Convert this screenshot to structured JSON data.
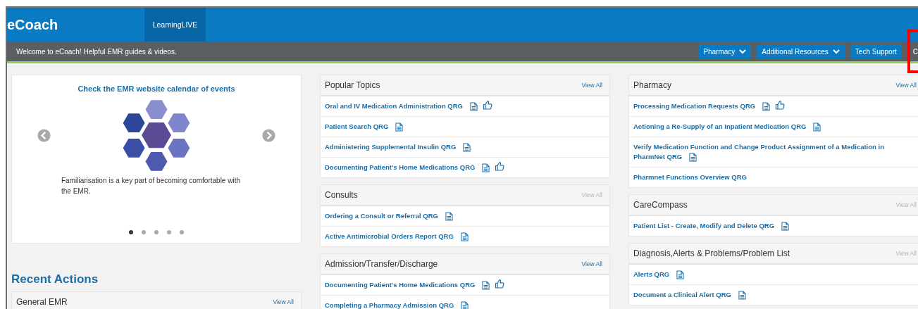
{
  "header": {
    "title": "eCoach",
    "tabs": [
      {
        "label": "LearningLIVE",
        "selected": true
      }
    ]
  },
  "nav": {
    "welcome": "Welcome to eCoach! Helpful EMR guides & videos.",
    "buttons": [
      {
        "label": "Pharmacy",
        "dropdown": true
      },
      {
        "label": "Additional Resources",
        "dropdown": true
      },
      {
        "label": "Tech Support",
        "dropdown": false
      },
      {
        "label": "C",
        "dropdown": false
      }
    ]
  },
  "annotation_frame": true,
  "carousel": {
    "heading": "Check the EMR website calendar of events",
    "caption": "Familiarisation is a key part of becoming comfortable with the EMR.",
    "dots": [
      {
        "selected": true
      },
      {
        "selected": false
      },
      {
        "selected": false
      },
      {
        "selected": false
      },
      {
        "selected": false
      }
    ]
  },
  "recent_actions": {
    "title": "Recent Actions",
    "panels": [
      {
        "title": "General EMR",
        "view_all": "View All",
        "view_all_enabled": true
      }
    ]
  },
  "columns": [
    [
      {
        "title": "Popular Topics",
        "view_all": "View All",
        "view_all_enabled": true,
        "items": [
          {
            "label": "Oral and IV Medication Administration QRG",
            "document": true,
            "liked": true
          },
          {
            "label": "Patient Search QRG",
            "document": true,
            "liked": false
          },
          {
            "label": "Administering Supplemental Insulin QRG",
            "document": true,
            "liked": false
          },
          {
            "label": "Documenting Patient's Home Medications QRG",
            "document": true,
            "liked": true
          }
        ]
      },
      {
        "title": "Consults",
        "view_all": "View All",
        "view_all_enabled": false,
        "items": [
          {
            "label": "Ordering a Consult or Referral QRG",
            "document": true,
            "liked": false
          },
          {
            "label": "Active Antimicrobial Orders Report QRG",
            "document": true,
            "liked": false
          }
        ]
      },
      {
        "title": "Admission/Transfer/Discharge",
        "view_all": "View All",
        "view_all_enabled": true,
        "items": [
          {
            "label": "Documenting Patient's Home Medications QRG",
            "document": true,
            "liked": true
          },
          {
            "label": "Completing a Pharmacy Admission QRG",
            "document": true,
            "liked": false
          }
        ]
      }
    ],
    [
      {
        "title": "Pharmacy",
        "view_all": "View All",
        "view_all_enabled": true,
        "items": [
          {
            "label": "Processing Medication Requests QRG",
            "document": true,
            "liked": true
          },
          {
            "label": "Actioning a Re-Supply of an Inpatient Medication QRG",
            "document": true,
            "liked": false
          },
          {
            "label": "Verify Medication Function and Change Product Assignment of a Medication in PharmNet QRG",
            "document": true,
            "liked": false
          },
          {
            "label": "Pharmnet Functions Overview QRG",
            "document": false,
            "liked": false
          }
        ]
      },
      {
        "title": "CareCompass",
        "view_all": "View All",
        "view_all_enabled": false,
        "items": [
          {
            "label": "Patient List - Create, Modify and Delete QRG",
            "document": true,
            "liked": false
          }
        ]
      },
      {
        "title": "Diagnosis,Alerts & Problems/Problem List",
        "view_all": "View All",
        "view_all_enabled": false,
        "items": [
          {
            "label": "Alerts QRG",
            "document": true,
            "liked": false
          },
          {
            "label": "Document a Clinical Alert QRG",
            "document": true,
            "liked": false
          }
        ]
      }
    ]
  ]
}
